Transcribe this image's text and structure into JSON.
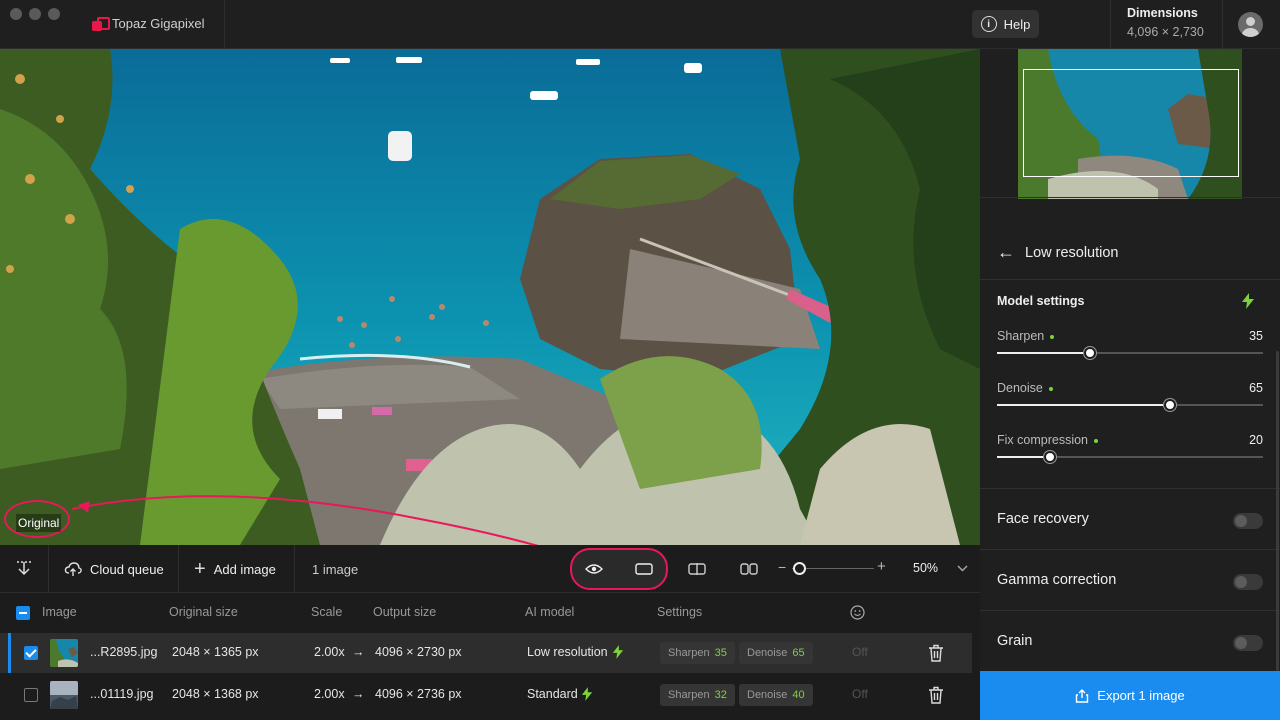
{
  "app": {
    "name": "Topaz Gigapixel"
  },
  "header": {
    "help_label": "Help",
    "dimensions_title": "Dimensions",
    "dimensions_value": "4,096 × 2,730"
  },
  "preview": {
    "label": "Original"
  },
  "panel": {
    "back_title": "Low resolution",
    "model_settings_title": "Model settings",
    "sliders": [
      {
        "label": "Sharpen",
        "value": "35",
        "fraction": 0.35
      },
      {
        "label": "Denoise",
        "value": "65",
        "fraction": 0.65
      },
      {
        "label": "Fix compression",
        "value": "20",
        "fraction": 0.2
      }
    ],
    "toggles": [
      {
        "label": "Face recovery",
        "on": false
      },
      {
        "label": "Gamma correction",
        "on": false
      },
      {
        "label": "Grain",
        "on": false
      }
    ],
    "export_label": "Export 1 image"
  },
  "toolbar": {
    "cloud_queue_label": "Cloud queue",
    "add_image_label": "Add image",
    "image_count": "1 image",
    "zoom_level": "50%",
    "zoom_fraction": 0.5
  },
  "table": {
    "columns": [
      "Image",
      "Original size",
      "Scale",
      "Output size",
      "AI model",
      "Settings"
    ],
    "rows": [
      {
        "selected": true,
        "name": "...R2895.jpg",
        "original_size": "2048 × 1365 px",
        "scale": "2.00x",
        "arrow": "→",
        "output_size": "4096 × 2730 px",
        "model": "Low resolution",
        "sharpen_label": "Sharpen",
        "sharpen": "35",
        "denoise_label": "Denoise",
        "denoise": "65",
        "face": "Off"
      },
      {
        "selected": false,
        "name": "...01119.jpg",
        "original_size": "2048 × 1368 px",
        "scale": "2.00x",
        "arrow": "→",
        "output_size": "4096 × 2736 px",
        "model": "Standard",
        "sharpen_label": "Sharpen",
        "sharpen": "32",
        "denoise_label": "Denoise",
        "denoise": "40",
        "face": "Off"
      }
    ]
  },
  "colors": {
    "accent": "#1a8cf0",
    "brand": "#e8184a",
    "annotation": "#e8185a",
    "active": "#7bd43a"
  }
}
